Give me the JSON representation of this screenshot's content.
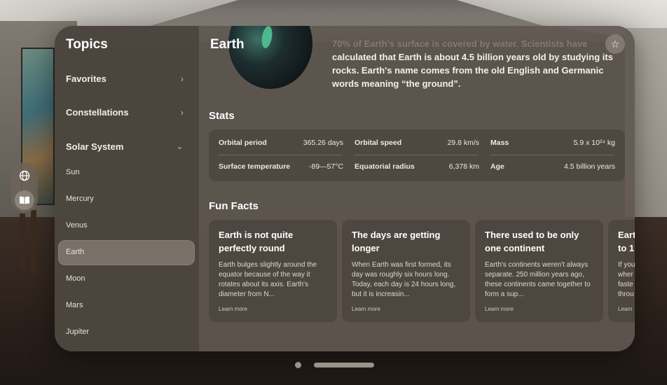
{
  "sidebar": {
    "title": "Topics",
    "sections": [
      {
        "label": "Favorites",
        "chevron": "›"
      },
      {
        "label": "Constellations",
        "chevron": "›"
      },
      {
        "label": "Solar System",
        "chevron": "⌄"
      }
    ],
    "planets": [
      "Sun",
      "Mercury",
      "Venus",
      "Earth",
      "Moon",
      "Mars",
      "Jupiter"
    ],
    "selected": "Earth"
  },
  "ornament": {
    "globe_icon": "globe-icon",
    "book_icon": "book-icon"
  },
  "main": {
    "title": "Earth",
    "description_faded": "70% of Earth's surface is covered by water. Scientists have",
    "description": "calculated that Earth is about 4.5 billion years old by studying its rocks. Earth's name comes from the old English and Germanic words meaning “the ground”.",
    "favorite_icon": "☆",
    "stats_title": "Stats",
    "stats": [
      {
        "label": "Orbital period",
        "value": "365.26 days"
      },
      {
        "label": "Orbital speed",
        "value": "29.8 km/s"
      },
      {
        "label": "Mass",
        "value": "5.9 x 10²⁴ kg"
      },
      {
        "label": "Surface temperature",
        "value": "-89—57°C"
      },
      {
        "label": "Equatorial radius",
        "value": "6,378 km"
      },
      {
        "label": "Age",
        "value": "4.5 billion years"
      }
    ],
    "fun_facts_title": "Fun Facts",
    "facts": [
      {
        "title": "Earth is not quite perfectly round",
        "body": "Earth bulges slightly around the equator because of the way it rotates about its axis. Earth's diameter from N...",
        "link": "Learn more"
      },
      {
        "title": "The days are getting longer",
        "body": "When Earth was first formed, its day was roughly six hours long. Today, each day is 24 hours long, but it is increasin...",
        "link": "Learn more"
      },
      {
        "title": "There used to be only one continent",
        "body": "Earth's continents weren't always separate. 250 million years ago, these continents came together to form a sup...",
        "link": "Learn more"
      },
      {
        "title": "Eart to 1",
        "body": "If you wher faste throu",
        "link": "Learn"
      }
    ]
  },
  "colors": {
    "window": "#605850",
    "sidebar": "#4a443d",
    "card": "#4a443d"
  }
}
